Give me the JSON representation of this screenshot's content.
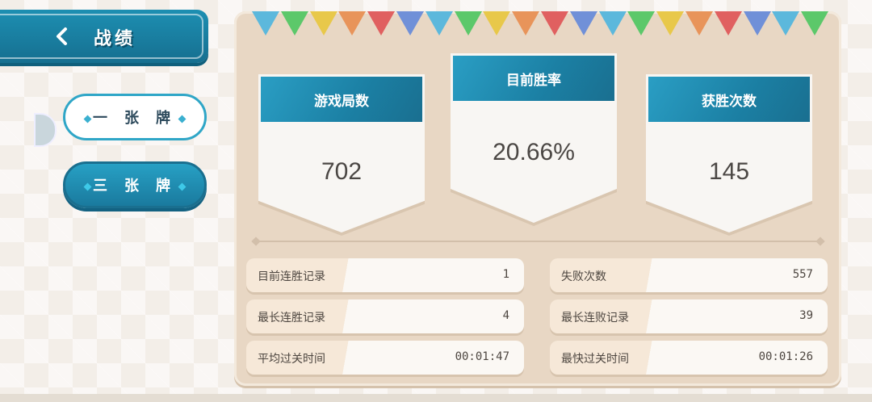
{
  "header": {
    "title": "战绩",
    "back_icon": "chevron-left-icon"
  },
  "modes": [
    {
      "label": "一 张 牌",
      "selected": false
    },
    {
      "label": "三 张 牌",
      "selected": true
    }
  ],
  "bunting_colors": [
    "#5cb8dc",
    "#5cc86a",
    "#e8c84a",
    "#e8945a",
    "#e06060",
    "#7090d8",
    "#5cb8dc",
    "#5cc86a",
    "#e8c84a",
    "#e8945a",
    "#e06060",
    "#7090d8",
    "#5cb8dc",
    "#5cc86a",
    "#e8c84a",
    "#e8945a",
    "#e06060",
    "#7090d8",
    "#5cb8dc",
    "#5cc86a"
  ],
  "stats": {
    "games": {
      "label": "游戏局数",
      "value": "702"
    },
    "win_rate": {
      "label": "目前胜率",
      "value": "20.66%"
    },
    "wins": {
      "label": "获胜次数",
      "value": "145"
    }
  },
  "records": {
    "current_streak": {
      "label": "目前连胜记录",
      "value": "1"
    },
    "losses": {
      "label": "失败次数",
      "value": "557"
    },
    "longest_streak": {
      "label": "最长连胜记录",
      "value": "4"
    },
    "longest_losing": {
      "label": "最长连败记录",
      "value": "39"
    },
    "avg_time": {
      "label": "平均过关时间",
      "value": "00:01:47"
    },
    "fastest_time": {
      "label": "最快过关时间",
      "value": "00:01:26"
    }
  },
  "colors": {
    "accent": "#1d8fb2",
    "panel": "#e8d7c4"
  }
}
